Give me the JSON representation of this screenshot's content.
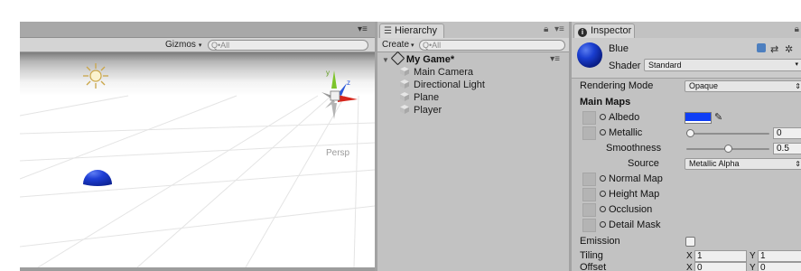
{
  "scene": {
    "gizmos_label": "Gizmos",
    "search_placeholder": "Q•All",
    "persp_label": "Persp",
    "gizmo_axes": {
      "y": "y",
      "z": "z"
    }
  },
  "hierarchy": {
    "tab_label": "Hierarchy",
    "create_label": "Create",
    "search_placeholder": "Q•All",
    "scene_name": "My Game*",
    "items": [
      {
        "label": "Main Camera"
      },
      {
        "label": "Directional Light"
      },
      {
        "label": "Plane"
      },
      {
        "label": "Player"
      }
    ]
  },
  "inspector": {
    "tab_label": "Inspector",
    "material_name": "Blue",
    "shader_label": "Shader",
    "shader_value": "Standard",
    "rendering_mode_label": "Rendering Mode",
    "rendering_mode_value": "Opaque",
    "main_maps_label": "Main Maps",
    "albedo_label": "Albedo",
    "albedo_color": "#0f3ef5",
    "metallic_label": "Metallic",
    "metallic_value": "0",
    "metallic_fraction": 0.0,
    "smoothness_label": "Smoothness",
    "smoothness_value": "0.5",
    "smoothness_fraction": 0.5,
    "source_label": "Source",
    "source_value": "Metallic Alpha",
    "normal_map_label": "Normal Map",
    "height_map_label": "Height Map",
    "occlusion_label": "Occlusion",
    "detail_mask_label": "Detail Mask",
    "emission_label": "Emission",
    "emission_checked": false,
    "tiling_label": "Tiling",
    "tiling_x": "1",
    "tiling_y": "1",
    "offset_label": "Offset",
    "offset_x": "0",
    "offset_y": "0",
    "x_label": "X",
    "y_label": "Y"
  },
  "colors": {
    "material_blue": "#1a3ed0",
    "sphere_blue": "#1f3fd6",
    "gizmo_x": "#d6261c",
    "gizmo_y": "#7dc42a",
    "gizmo_z": "#2b57d9"
  }
}
